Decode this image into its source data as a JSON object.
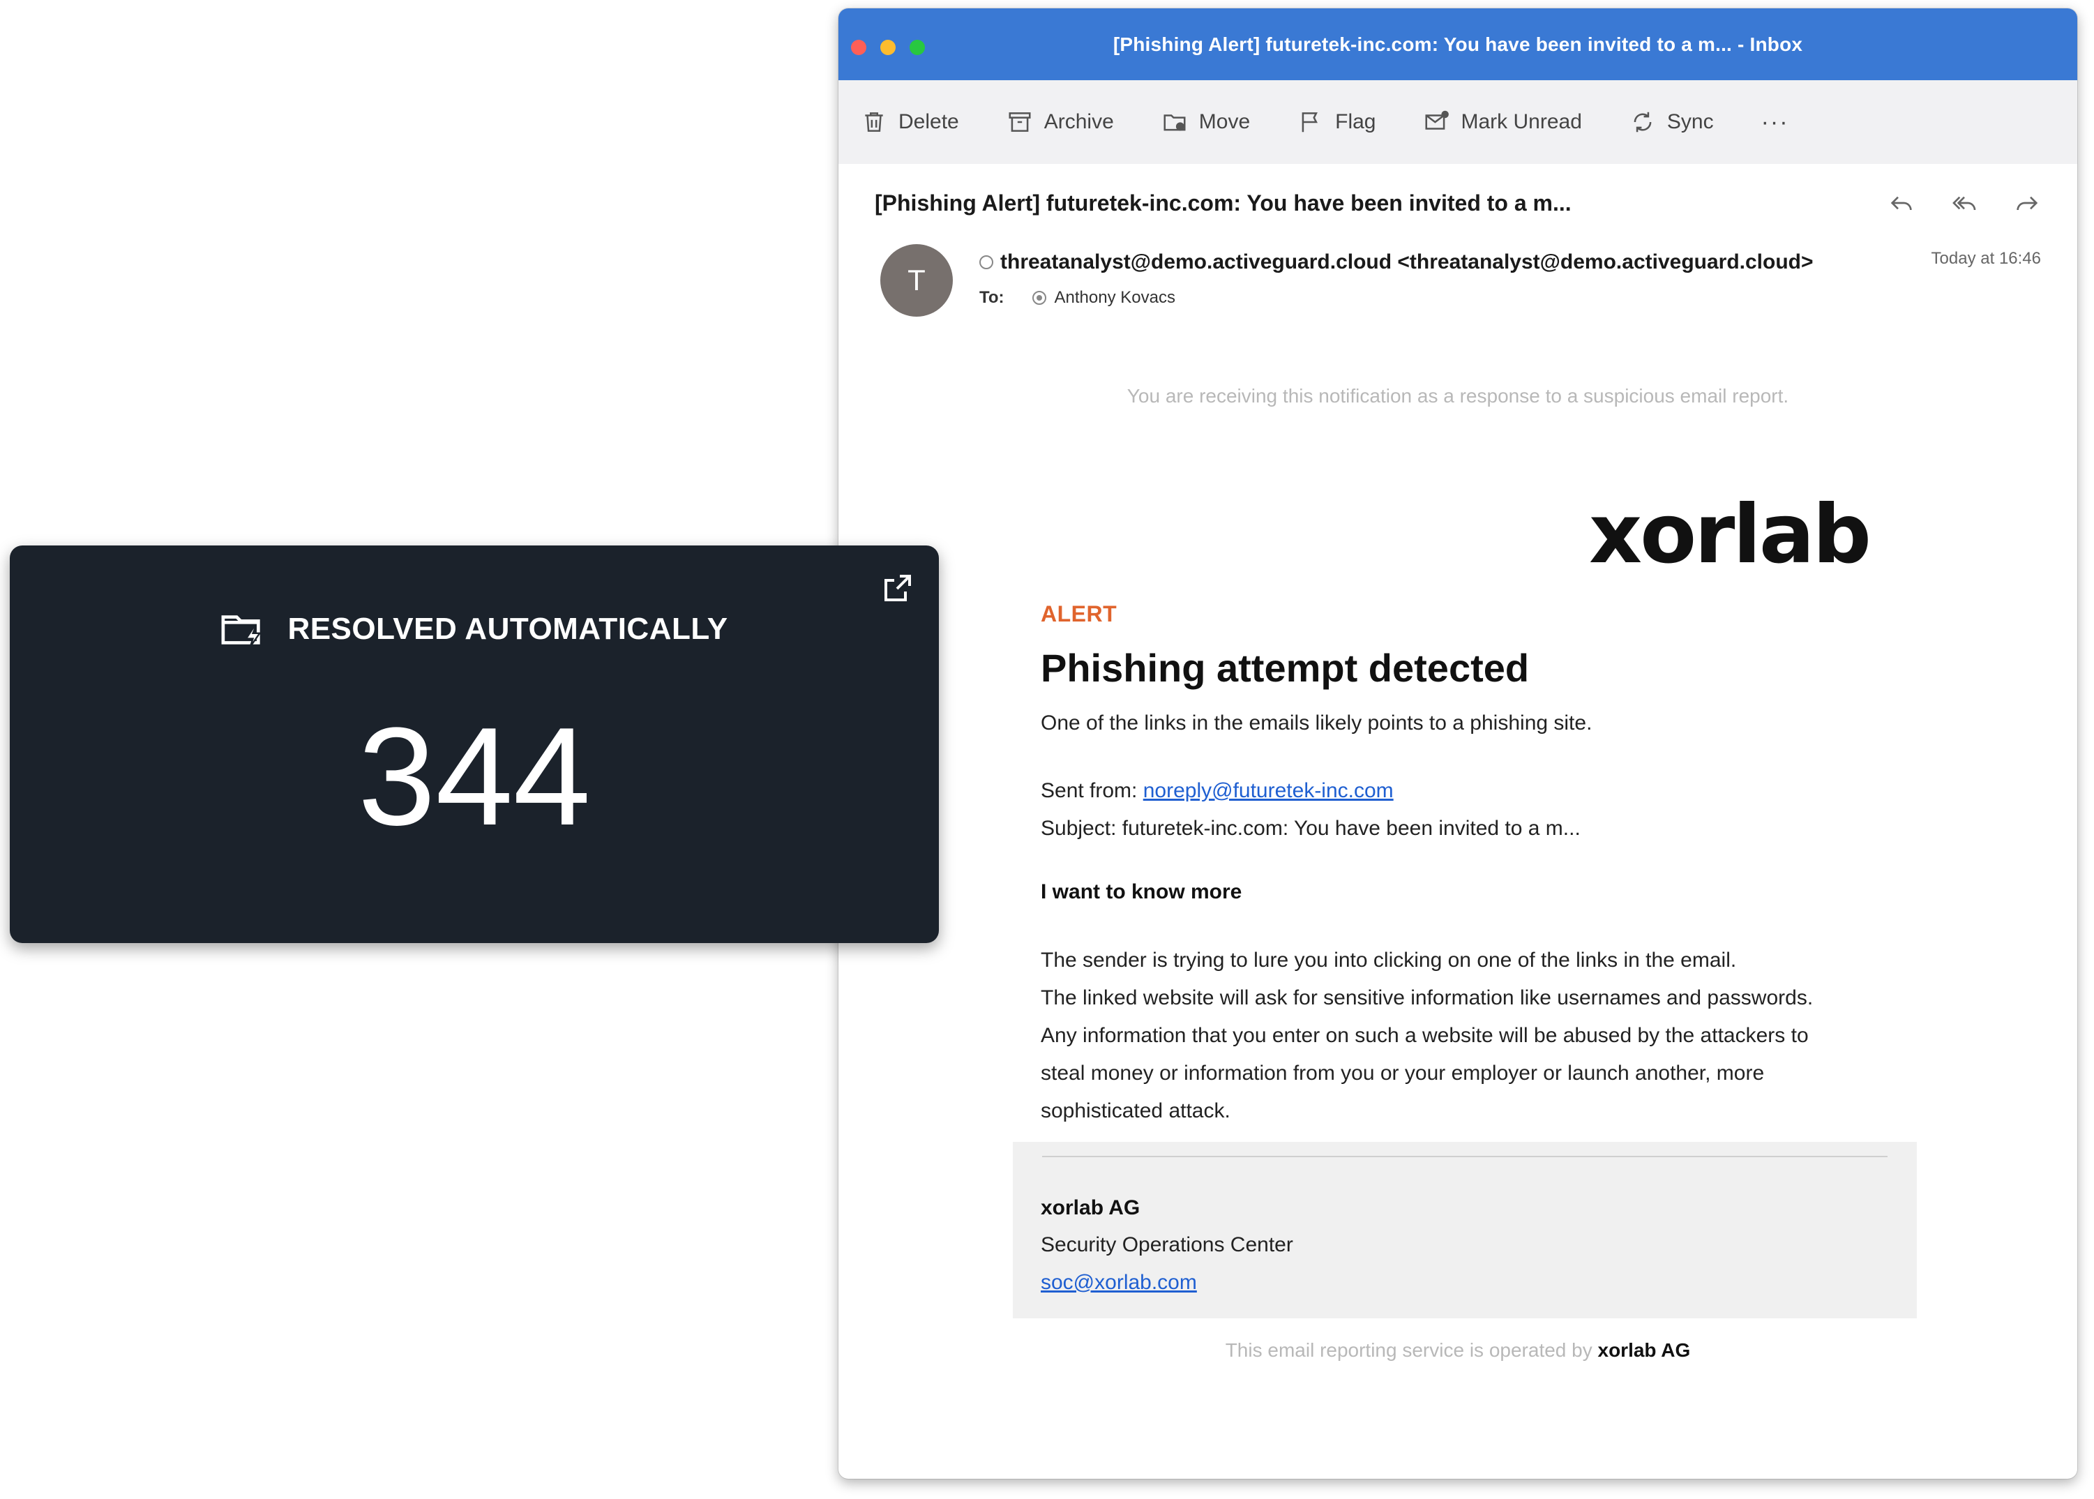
{
  "window": {
    "title": "[Phishing Alert] futuretek-inc.com: You have been invited to a m... - Inbox"
  },
  "toolbar": {
    "delete": "Delete",
    "archive": "Archive",
    "move": "Move",
    "flag": "Flag",
    "mark_unread": "Mark Unread",
    "sync": "Sync",
    "more": "···"
  },
  "message": {
    "subject": "[Phishing Alert] futuretek-inc.com: You have been invited to a m...",
    "avatar_initial": "T",
    "sender": "threatanalyst@demo.activeguard.cloud <threatanalyst@demo.activeguard.cloud>",
    "to_label": "To:",
    "recipient": "Anthony Kovacs",
    "time": "Today at 16:46"
  },
  "body": {
    "notice": "You are receiving this notification as a response to a suspicious email report.",
    "logo_text": "xorlab",
    "alert_label": "ALERT",
    "headline": "Phishing attempt detected",
    "lead": "One of the links in the emails likely points to a phishing site.",
    "sent_from_label": "Sent from:",
    "sent_from_email": "noreply@futuretek-inc.com",
    "subject_line": "Subject: futuretek-inc.com: You have been invited to a m...",
    "more_heading": "I want to know more",
    "paragraph": [
      "The sender is trying to lure you into clicking on one of the links in the email.",
      "The linked website will ask for sensitive information like usernames and passwords.",
      "Any information that you enter on such a website will be abused by the attackers to",
      "steal money or information from you or your employer or launch another, more",
      "sophisticated attack."
    ],
    "signature": {
      "company": "xorlab AG",
      "department": "Security Operations Center",
      "email": "soc@xorlab.com"
    },
    "footer_text": "This email reporting service is operated by",
    "footer_company": "xorlab AG"
  },
  "card": {
    "title": "RESOLVED AUTOMATICALLY",
    "value": "344",
    "icon": "folder-bolt-icon",
    "ext_icon": "external-link-icon"
  },
  "colors": {
    "titlebar": "#3a79d4",
    "alert": "#e0642d",
    "card_bg": "#1b222b",
    "link": "#1f5fd1"
  }
}
